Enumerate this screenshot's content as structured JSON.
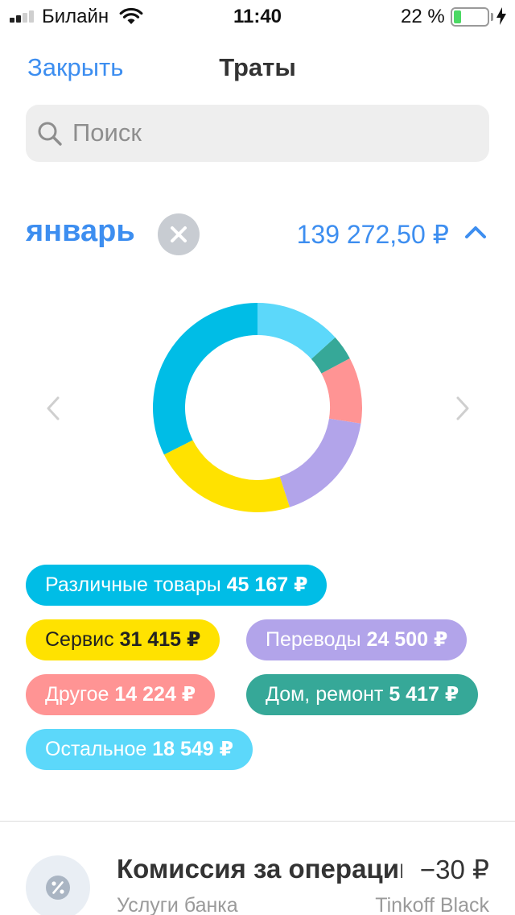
{
  "status_bar": {
    "carrier": "Билайн",
    "time": "11:40",
    "battery_percent": "22 %",
    "battery_level": 0.22
  },
  "nav": {
    "close_label": "Закрыть",
    "title": "Траты"
  },
  "search": {
    "placeholder": "Поиск",
    "value": ""
  },
  "period": {
    "month": "январь",
    "total": "139 272,50 ₽"
  },
  "chart_data": {
    "type": "pie",
    "categories": [
      "Различные товары",
      "Сервис",
      "Переводы",
      "Другое",
      "Дом, ремонт",
      "Остальное"
    ],
    "values": [
      45167,
      31415,
      24500,
      14224,
      5417,
      18549
    ],
    "colors": [
      "#00bde6",
      "#ffe200",
      "#b2a4ea",
      "#ff9494",
      "#36a898",
      "#5cd8fa"
    ]
  },
  "categories": [
    {
      "name": "Различные товары",
      "amount": "45 167 ₽",
      "color": "#00bde6"
    },
    {
      "name": "Сервис",
      "amount": "31 415 ₽",
      "color": "#ffe200"
    },
    {
      "name": "Переводы",
      "amount": "24 500 ₽",
      "color": "#b2a4ea"
    },
    {
      "name": "Другое",
      "amount": "14 224 ₽",
      "color": "#ff9494"
    },
    {
      "name": "Дом, ремонт",
      "amount": "5 417 ₽",
      "color": "#36a898"
    },
    {
      "name": "Остальное",
      "amount": "18 549 ₽",
      "color": "#5cd8fa"
    }
  ],
  "transactions": [
    {
      "title": "Комиссия за операции",
      "amount": "−30 ₽",
      "category": "Услуги банка",
      "card": "Tinkoff Black",
      "icon": "percent-icon"
    }
  ],
  "colors": {
    "accent": "#3d8ef0",
    "search_bg": "#eeeeee"
  }
}
